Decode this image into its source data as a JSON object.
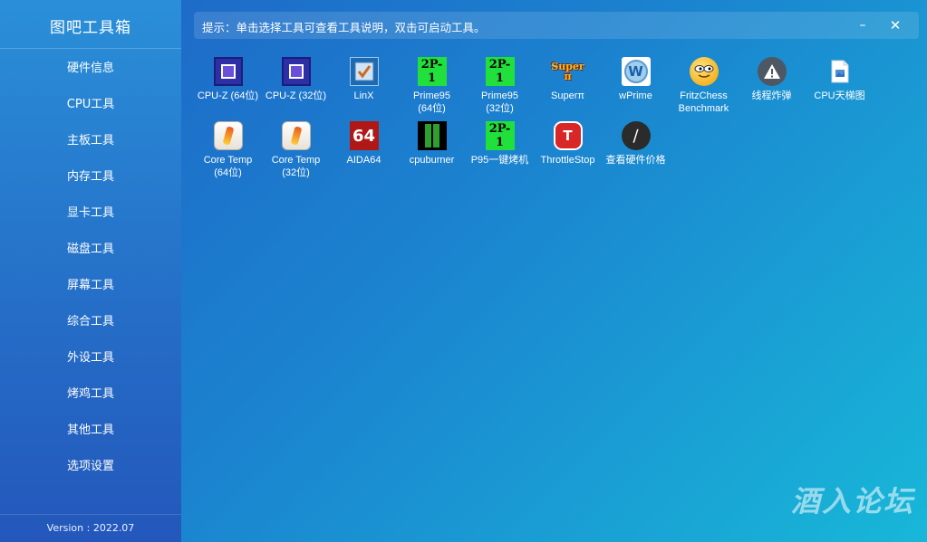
{
  "app": {
    "title": "图吧工具箱",
    "version": "Version : 2022.07"
  },
  "sidebar": {
    "items": [
      {
        "label": "硬件信息"
      },
      {
        "label": "CPU工具"
      },
      {
        "label": "主板工具"
      },
      {
        "label": "内存工具"
      },
      {
        "label": "显卡工具"
      },
      {
        "label": "磁盘工具"
      },
      {
        "label": "屏幕工具"
      },
      {
        "label": "综合工具"
      },
      {
        "label": "外设工具"
      },
      {
        "label": "烤鸡工具"
      },
      {
        "label": "其他工具"
      },
      {
        "label": "选项设置"
      }
    ]
  },
  "hint": {
    "text": "提示：单击选择工具可查看工具说明，双击可启动工具。",
    "minimize": "–",
    "close": "✕"
  },
  "tools": [
    {
      "line1": "CPU-Z (64位)",
      "line2": "",
      "icon": "cpu-z-icon"
    },
    {
      "line1": "CPU-Z (32位)",
      "line2": "",
      "icon": "cpu-z-icon"
    },
    {
      "line1": "LinX",
      "line2": "",
      "icon": "linx-icon"
    },
    {
      "line1": "Prime95",
      "line2": "(64位)",
      "icon": "prime95-icon"
    },
    {
      "line1": "Prime95",
      "line2": "(32位)",
      "icon": "prime95-icon"
    },
    {
      "line1": "Superπ",
      "line2": "",
      "icon": "superpi-icon"
    },
    {
      "line1": "wPrime",
      "line2": "",
      "icon": "wprime-icon"
    },
    {
      "line1": "FritzChess",
      "line2": "Benchmark",
      "icon": "fritz-icon"
    },
    {
      "line1": "线程炸弹",
      "line2": "",
      "icon": "warning-icon"
    },
    {
      "line1": "CPU天梯图",
      "line2": "",
      "icon": "image-file-icon"
    },
    {
      "line1": "Core Temp",
      "line2": "(64位)",
      "icon": "coretemp-icon"
    },
    {
      "line1": "Core Temp",
      "line2": "(32位)",
      "icon": "coretemp-icon"
    },
    {
      "line1": "AIDA64",
      "line2": "",
      "icon": "aida64-icon"
    },
    {
      "line1": "cpuburner",
      "line2": "",
      "icon": "cpuburner-icon"
    },
    {
      "line1": "P95一键烤机",
      "line2": "",
      "icon": "prime95-icon"
    },
    {
      "line1": "ThrottleStop",
      "line2": "",
      "icon": "throttlestop-icon"
    },
    {
      "line1": "查看硬件价格",
      "line2": "",
      "icon": "price-icon"
    }
  ],
  "icon_text": {
    "prime": "2P-1",
    "super": "Super\nπ",
    "wprime": "W",
    "aida": "64",
    "throttle": "T",
    "price": "∕"
  },
  "watermark": "酒入论坛",
  "colors": {
    "sidebar_top": "#2a8fd8",
    "sidebar_bottom": "#2457bb",
    "main_gradient_start": "#1f63c6",
    "main_gradient_end": "#18b7d8",
    "prime95_green": "#22e03c",
    "aida_red": "#b01818"
  }
}
